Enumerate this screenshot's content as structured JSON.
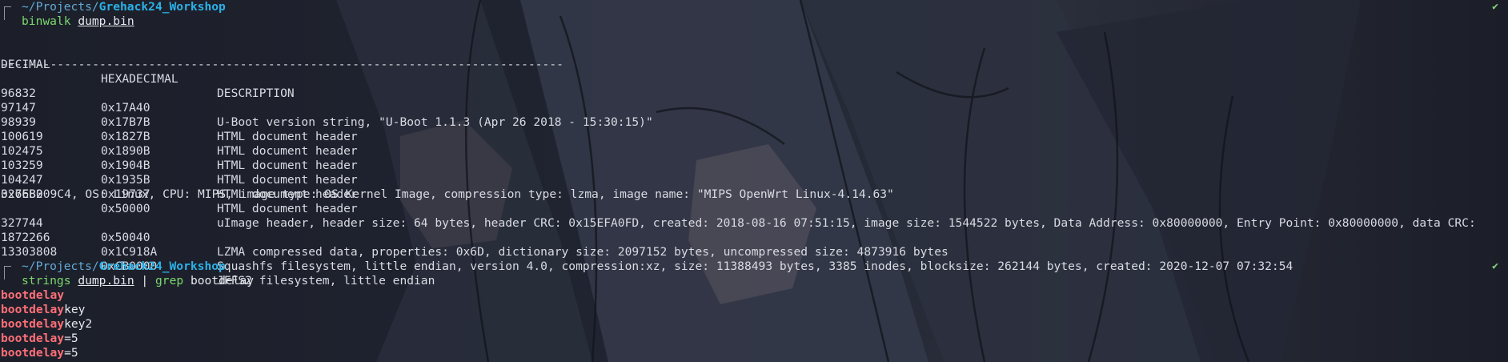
{
  "prompt1": {
    "path_prefix": "~/Projects/",
    "path_dir": "Grehack24_Workshop",
    "command": "binwalk",
    "arg": "dump.bin",
    "status": "✔"
  },
  "binwalk": {
    "headers": [
      "DECIMAL",
      "HEXADECIMAL",
      "DESCRIPTION"
    ],
    "separator": "--------------------------------------------------------------------------------",
    "rows": [
      {
        "decimal": "96832",
        "hex": "0x17A40",
        "desc": "U-Boot version string, \"U-Boot 1.1.3 (Apr 26 2018 - 15:30:15)\""
      },
      {
        "decimal": "97147",
        "hex": "0x17B7B",
        "desc": "HTML document header"
      },
      {
        "decimal": "98939",
        "hex": "0x1827B",
        "desc": "HTML document header"
      },
      {
        "decimal": "100619",
        "hex": "0x1890B",
        "desc": "HTML document header"
      },
      {
        "decimal": "102475",
        "hex": "0x1904B",
        "desc": "HTML document header"
      },
      {
        "decimal": "103259",
        "hex": "0x1935B",
        "desc": "HTML document header"
      },
      {
        "decimal": "104247",
        "hex": "0x19737",
        "desc": "HTML document header"
      },
      {
        "decimal": "327680",
        "hex": "0x50000",
        "desc": "uImage header, header size: 64 bytes, header CRC: 0x15EFA0FD, created: 2018-08-16 07:51:15, image size: 1544522 bytes, Data Address: 0x80000000, Entry Point: 0x80000000, data CRC:"
      },
      {
        "decimal": "",
        "hex": "",
        "desc": "0x6EB209C4, OS: Linux, CPU: MIPS, image type: OS Kernel Image, compression type: lzma, image name: \"MIPS OpenWrt Linux-4.14.63\"",
        "wrap": true
      },
      {
        "decimal": "327744",
        "hex": "0x50040",
        "desc": "LZMA compressed data, properties: 0x6D, dictionary size: 2097152 bytes, uncompressed size: 4873916 bytes"
      },
      {
        "decimal": "1872266",
        "hex": "0x1C918A",
        "desc": "Squashfs filesystem, little endian, version 4.0, compression:xz, size: 11388493 bytes, 3385 inodes, blocksize: 262144 bytes, created: 2020-12-07 07:32:54"
      },
      {
        "decimal": "13303808",
        "hex": "0xCB0000",
        "desc": "JFFS2 filesystem, little endian"
      }
    ]
  },
  "prompt2": {
    "path_prefix": "~/Projects/",
    "path_dir": "Grehack24_Workshop",
    "command": "strings",
    "arg": "dump.bin",
    "pipe": "|",
    "command2": "grep",
    "pattern": "bootdelay",
    "status": "✔"
  },
  "grep_output": [
    {
      "match": "bootdelay",
      "rest": ""
    },
    {
      "match": "bootdelay",
      "rest": "key"
    },
    {
      "match": "bootdelay",
      "rest": "key2"
    },
    {
      "match": "bootdelay",
      "rest": "=5"
    },
    {
      "match": "bootdelay",
      "rest": "=5"
    }
  ],
  "colors": {
    "background": "#1d202b",
    "path": "#2bb1e8",
    "command": "#7ad86d",
    "match": "#ff6f78",
    "check": "#84d47c"
  }
}
